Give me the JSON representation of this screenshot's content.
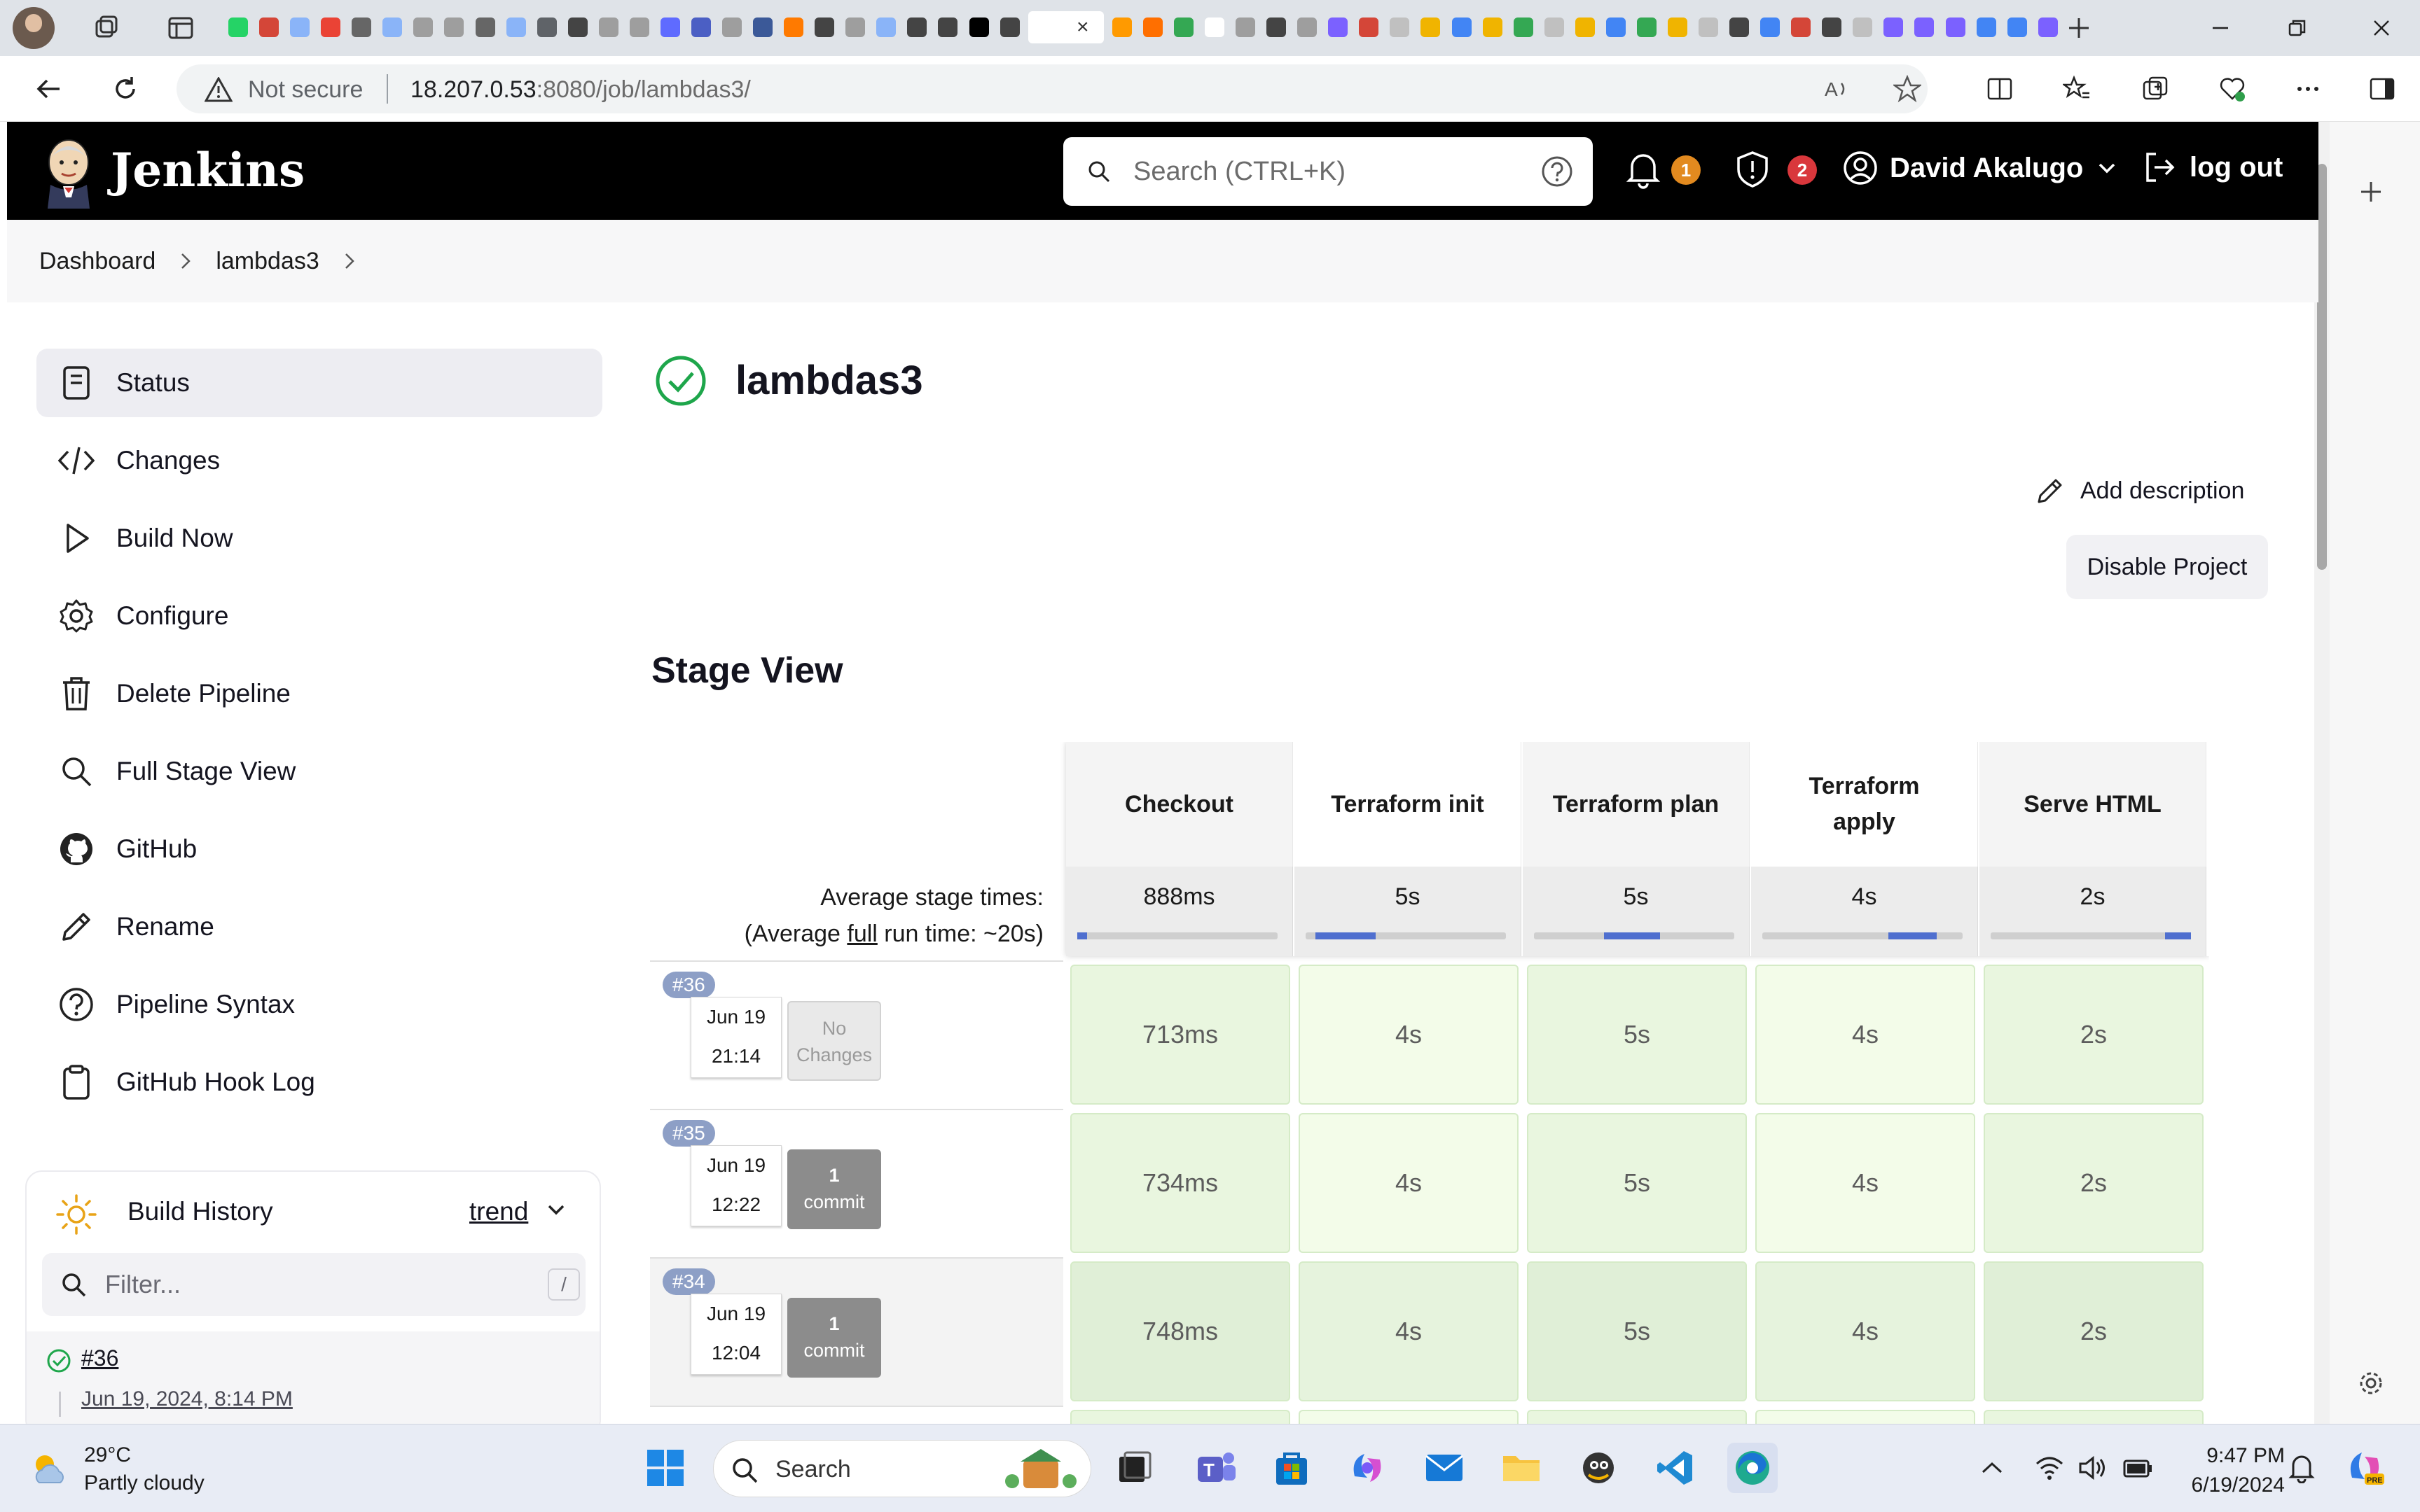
{
  "browser": {
    "security_label": "Not secure",
    "url_host": "18.207.0.53",
    "url_rest": ":8080/job/lambdas3/",
    "tab_colors": [
      "#25d366",
      "#d44638",
      "#8ab4f8",
      "#ea4335",
      "#666666",
      "#8ab4f8",
      "#9e9e9e",
      "#9e9e9e",
      "#666666",
      "#8ab4f8",
      "#5f6368",
      "#444444",
      "#9e9e9e",
      "#9e9e9e",
      "#5f6bff",
      "#4b5fc4",
      "#9e9e9e",
      "#3b5998",
      "#ff7a00",
      "#444444",
      "#9e9e9e",
      "#8ab4f8",
      "#444444",
      "#444444",
      "#000000",
      "#444444",
      "#ffffff",
      "#ff9a00",
      "#ff6f00",
      "#34a853",
      "#ffffff",
      "#9e9e9e",
      "#444444",
      "#9e9e9e",
      "#7b61ff",
      "#d44638",
      "#c0c0c0",
      "#f0b400",
      "#4285f4",
      "#f0b400",
      "#34a853",
      "#c0c0c0",
      "#f0b400",
      "#4285f4",
      "#34a853",
      "#f0b400",
      "#c0c0c0",
      "#444444",
      "#4285f4",
      "#d44638",
      "#444444",
      "#c0c0c0",
      "#7b61ff",
      "#7b61ff",
      "#7b61ff",
      "#4285f4",
      "#4285f4",
      "#7b61ff"
    ]
  },
  "header": {
    "brand": "Jenkins",
    "search_placeholder": "Search (CTRL+K)",
    "notifications_count": "1",
    "security_count": "2",
    "user_name": "David Akalugo",
    "logout_label": "log out",
    "notif_color": "#e28a1f",
    "security_color": "#d9373c"
  },
  "breadcrumbs": [
    "Dashboard",
    "lambdas3"
  ],
  "sidebar": {
    "items": [
      {
        "label": "Status",
        "icon": "status-icon"
      },
      {
        "label": "Changes",
        "icon": "code-icon"
      },
      {
        "label": "Build Now",
        "icon": "play-icon"
      },
      {
        "label": "Configure",
        "icon": "gear-icon"
      },
      {
        "label": "Delete Pipeline",
        "icon": "trash-icon"
      },
      {
        "label": "Full Stage View",
        "icon": "search-icon"
      },
      {
        "label": "GitHub",
        "icon": "github-icon"
      },
      {
        "label": "Rename",
        "icon": "pencil-icon"
      },
      {
        "label": "Pipeline Syntax",
        "icon": "help-icon"
      },
      {
        "label": "GitHub Hook Log",
        "icon": "clipboard-icon"
      }
    ]
  },
  "build_history": {
    "title": "Build History",
    "trend_label": "trend",
    "filter_placeholder": "Filter...",
    "filter_shortcut": "/",
    "entries": [
      {
        "number": "#36",
        "date": "Jun 19, 2024, 8:14 PM"
      }
    ]
  },
  "job": {
    "title": "lambdas3",
    "add_description": "Add description",
    "disable_button": "Disable Project",
    "success_color": "#1ea64b"
  },
  "stage_view": {
    "title": "Stage View",
    "stages": [
      "Checkout",
      "Terraform init",
      "Terraform plan",
      "Terraform apply",
      "Serve HTML"
    ],
    "average_label": "Average stage times:",
    "average_full_prefix": "(Average ",
    "average_full_word": "full",
    "average_full_suffix": " run time: ~20s)",
    "average_times": [
      "888ms",
      "5s",
      "5s",
      "4s",
      "2s"
    ],
    "average_bar_segments": [
      [
        0,
        0.05
      ],
      [
        0.05,
        0.35
      ],
      [
        0.35,
        0.63
      ],
      [
        0.63,
        0.87
      ],
      [
        0.87,
        1.0
      ]
    ],
    "builds": [
      {
        "number": "#36",
        "date": "Jun 19",
        "time": "21:14",
        "changes_line1": "No",
        "changes_line2": "Changes",
        "has_changes": false,
        "durations": [
          "713ms",
          "4s",
          "5s",
          "4s",
          "2s"
        ]
      },
      {
        "number": "#35",
        "date": "Jun 19",
        "time": "12:22",
        "changes_line1": "1",
        "changes_line2": "commit",
        "has_changes": true,
        "durations": [
          "734ms",
          "4s",
          "5s",
          "4s",
          "2s"
        ]
      },
      {
        "number": "#34",
        "date": "Jun 19",
        "time": "12:04",
        "changes_line1": "1",
        "changes_line2": "commit",
        "has_changes": true,
        "durations": [
          "748ms",
          "4s",
          "5s",
          "4s",
          "2s"
        ]
      }
    ]
  },
  "taskbar": {
    "temperature": "29°C",
    "weather": "Partly cloudy",
    "search_label": "Search",
    "time": "9:47 PM",
    "date": "6/19/2024"
  }
}
